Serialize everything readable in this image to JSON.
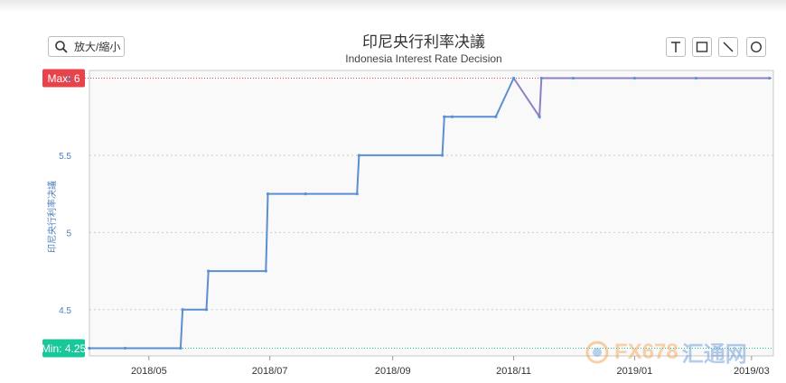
{
  "toolbar": {
    "zoom_label": "放大/縮小",
    "tools": [
      {
        "icon": "text-tool-icon"
      },
      {
        "icon": "rectangle-tool-icon"
      },
      {
        "icon": "line-tool-icon"
      },
      {
        "icon": "circle-tool-icon"
      }
    ]
  },
  "colors": {
    "line": "#5b8fd1",
    "max": "#e8434b",
    "min": "#19c79b",
    "grid": "#cccccc",
    "plot_bg": "#f9f9fa"
  },
  "watermark": {
    "text_a": "FX678",
    "text_b": "汇通网"
  },
  "chart_data": {
    "type": "line",
    "title": "印尼央行利率决議",
    "subtitle": "Indonesia Interest Rate Decision",
    "ylabel": "印尼央行利率决議",
    "xlabel": "",
    "ylim": [
      4.2,
      6.05
    ],
    "xlim": [
      "2018-04-01",
      "2019-03-12"
    ],
    "yticks": [
      {
        "v": 4.5,
        "label": "4.5"
      },
      {
        "v": 5,
        "label": "5"
      },
      {
        "v": 5.5,
        "label": "5.5"
      },
      {
        "v": 6,
        "label": "6"
      }
    ],
    "xticks": [
      {
        "date": "2018-05-01",
        "label": "2018/05"
      },
      {
        "date": "2018-07-01",
        "label": "2018/07"
      },
      {
        "date": "2018-09-01",
        "label": "2018/09"
      },
      {
        "date": "2018-11-01",
        "label": "2018/11"
      },
      {
        "date": "2019-01-01",
        "label": "2019/01"
      },
      {
        "date": "2019-03-01",
        "label": "2019/03"
      }
    ],
    "grid": true,
    "max": {
      "value": 6,
      "label": "Max: 6"
    },
    "min": {
      "value": 4.25,
      "label": "Min: 4.25"
    },
    "series": [
      {
        "points": [
          {
            "x": "2018-04-01",
            "y": 4.25
          },
          {
            "x": "2018-04-19",
            "y": 4.25
          },
          {
            "x": "2018-05-17",
            "y": 4.25
          },
          {
            "x": "2018-05-18",
            "y": 4.5
          },
          {
            "x": "2018-05-30",
            "y": 4.5
          },
          {
            "x": "2018-05-31",
            "y": 4.75
          },
          {
            "x": "2018-06-29",
            "y": 4.75
          },
          {
            "x": "2018-06-30",
            "y": 5.25
          },
          {
            "x": "2018-07-19",
            "y": 5.25
          },
          {
            "x": "2018-08-14",
            "y": 5.25
          },
          {
            "x": "2018-08-15",
            "y": 5.5
          },
          {
            "x": "2018-09-26",
            "y": 5.5
          },
          {
            "x": "2018-09-27",
            "y": 5.75
          },
          {
            "x": "2018-10-01",
            "y": 5.75
          },
          {
            "x": "2018-10-23",
            "y": 5.75
          },
          {
            "x": "2018-11-01",
            "y": 6
          },
          {
            "x": "2018-11-14",
            "y": 5.75
          },
          {
            "x": "2018-11-15",
            "y": 6
          },
          {
            "x": "2018-12-01",
            "y": 6
          },
          {
            "x": "2019-01-01",
            "y": 6
          },
          {
            "x": "2019-02-01",
            "y": 6
          },
          {
            "x": "2019-03-10",
            "y": 6
          }
        ]
      }
    ]
  }
}
